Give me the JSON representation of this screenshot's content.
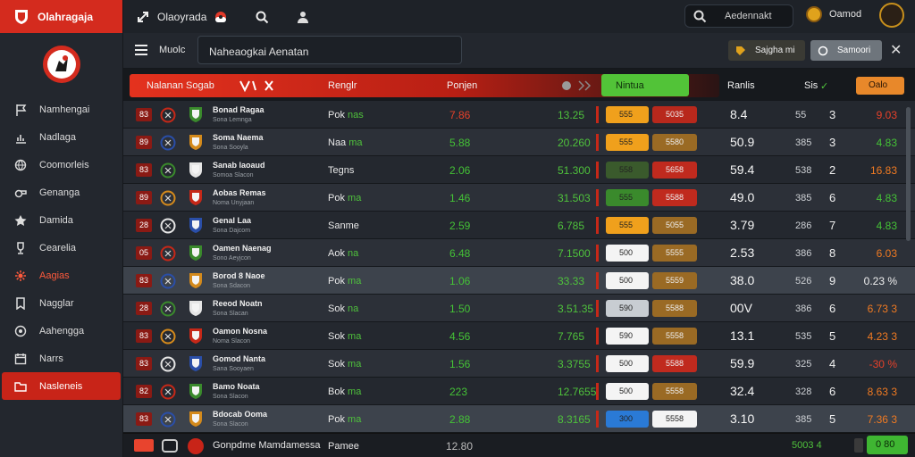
{
  "app": {
    "title": "Olahragaja"
  },
  "topbar": {
    "title": "Olaoyrada",
    "search_text": "Aedennakt",
    "coin_label": "Oamod"
  },
  "subbar": {
    "menu_label": "Muolc",
    "field_value": "Naheaogkai Aenatan",
    "btn1_label": "Sajgha mi",
    "btn2_label": "Samoori"
  },
  "sidebar": {
    "items": [
      {
        "label": "Namhengai",
        "icon": "flag-icon"
      },
      {
        "label": "Nadlaga",
        "icon": "chart-icon"
      },
      {
        "label": "Coomorleis",
        "icon": "globe-icon"
      },
      {
        "label": "Genanga",
        "icon": "whistle-icon"
      },
      {
        "label": "Damida",
        "icon": "star-icon"
      },
      {
        "label": "Cearelia",
        "icon": "trophy-icon"
      },
      {
        "label": "Aagias",
        "icon": "gear-icon"
      },
      {
        "label": "Nagglar",
        "icon": "bookmark-icon"
      },
      {
        "label": "Aahengga",
        "icon": "target-icon"
      },
      {
        "label": "Narrs",
        "icon": "calendar-icon"
      },
      {
        "label": "Nasleneis",
        "icon": "folder-icon"
      }
    ]
  },
  "table": {
    "headers": {
      "team": "Nalanan Sogab",
      "col2": "Renglr",
      "col3": "Ponjen",
      "col4": "Nintua",
      "col5": "Ranlis",
      "col7": "Sis",
      "col8": "Oalo"
    },
    "rows": [
      {
        "rank": "83",
        "team": "Bonad Ragaa",
        "sub": "Sona Lemnga",
        "c2a": "Pok",
        "c2b": "nas",
        "c3": "7.86",
        "c3c": "red",
        "c4": "13.25",
        "b1": "555",
        "b1c": "#f0a01c",
        "b2": "5035",
        "b2c": "#b8281c",
        "c5": "8.4",
        "c6": "55",
        "c7": "3",
        "c8": "9.03",
        "c8c": "red"
      },
      {
        "rank": "89",
        "team": "Soma Naema",
        "sub": "Sona Sooyla",
        "c2a": "Naa",
        "c2b": "ma",
        "c3": "5.88",
        "c3c": "green",
        "c4": "20.260",
        "b1": "555",
        "b1c": "#f0a01c",
        "b2": "5580",
        "b2c": "#9a6a24",
        "c5": "50.9",
        "c6": "385",
        "c7": "3",
        "c8": "4.83",
        "c8c": "green"
      },
      {
        "rank": "83",
        "team": "Sanab laoaud",
        "sub": "Somoa Slacon",
        "c2a": "Tegns",
        "c2b": "",
        "c3": "2.06",
        "c3c": "green",
        "c4": "51.300",
        "b1": "558",
        "b1c": "#3a5a2c",
        "b2": "5658",
        "b2c": "#c02a1e",
        "c5": "59.4",
        "c6": "538",
        "c7": "2",
        "c8": "16.83",
        "c8c": "orange"
      },
      {
        "rank": "89",
        "team": "Aobas Remas",
        "sub": "Noma Unyjaan",
        "c2a": "Pok",
        "c2b": "ma",
        "c3": "1.46",
        "c3c": "green",
        "c4": "31.503",
        "b1": "555",
        "b1c": "#3a8a2c",
        "b2": "5588",
        "b2c": "#c02a1e",
        "c5": "49.0",
        "c6": "385",
        "c7": "6",
        "c8": "4.83",
        "c8c": "green"
      },
      {
        "rank": "28",
        "team": "Genal Laa",
        "sub": "Sona Dajcom",
        "c2a": "Sanme",
        "c2b": "",
        "c3": "2.59",
        "c3c": "green",
        "c4": "6.785",
        "b1": "555",
        "b1c": "#f0a01c",
        "b2": "5055",
        "b2c": "#9a6a24",
        "c5": "3.79",
        "c6": "286",
        "c7": "7",
        "c8": "4.83",
        "c8c": "green"
      },
      {
        "rank": "05",
        "team": "Oamen Naenag",
        "sub": "Sono Aeyjcon",
        "c2a": "Aok",
        "c2b": "na",
        "c3": "6.48",
        "c3c": "green",
        "c4": "7.1500",
        "b1": "500",
        "b1c": "#f4f4f4",
        "b2": "5555",
        "b2c": "#9a6a24",
        "c5": "2.53",
        "c6": "386",
        "c7": "8",
        "c8": "6.03",
        "c8c": "orange"
      },
      {
        "rank": "83",
        "team": "Borod 8 Naoe",
        "sub": "Sona Sdacon",
        "c2a": "Pok",
        "c2b": "ma",
        "c3": "1.06",
        "c3c": "green",
        "c4": "33.33",
        "b1": "500",
        "b1c": "#f4f4f4",
        "b2": "5559",
        "b2c": "#9a6a24",
        "c5": "38.0",
        "c6": "526",
        "c7": "9",
        "c8": "0.23 %",
        "c8c": "white",
        "hl": true
      },
      {
        "rank": "28",
        "team": "Reeod Noatn",
        "sub": "Sona Slacan",
        "c2a": "Sok",
        "c2b": "na",
        "c3": "1.50",
        "c3c": "green",
        "c4": "3.51.35",
        "b1": "590",
        "b1c": "#c8cdd2",
        "b2": "5588",
        "b2c": "#9a6a24",
        "c5": "00V",
        "c6": "386",
        "c7": "6",
        "c8": "6.73 3",
        "c8c": "orange"
      },
      {
        "rank": "83",
        "team": "Oamon Nosna",
        "sub": "Noma Slacon",
        "c2a": "Sok",
        "c2b": "ma",
        "c3": "4.56",
        "c3c": "green",
        "c4": "7.765",
        "b1": "590",
        "b1c": "#f4f4f4",
        "b2": "5558",
        "b2c": "#9a6a24",
        "c5": "13.1",
        "c6": "535",
        "c7": "5",
        "c8": "4.23 3",
        "c8c": "orange"
      },
      {
        "rank": "83",
        "team": "Gomod Nanta",
        "sub": "Sana Sooyaen",
        "c2a": "Sok",
        "c2b": "ma",
        "c3": "1.56",
        "c3c": "green",
        "c4": "3.3755",
        "b1": "500",
        "b1c": "#f4f4f4",
        "b2": "5588",
        "b2c": "#c02a1e",
        "c5": "59.9",
        "c6": "325",
        "c7": "4",
        "c8": "-30 %",
        "c8c": "red"
      },
      {
        "rank": "82",
        "team": "Bamo Noata",
        "sub": "Sona Slacon",
        "c2a": "Bok",
        "c2b": "ma",
        "c3": "223",
        "c3c": "green",
        "c4": "12.7655",
        "b1": "500",
        "b1c": "#f4f4f4",
        "b2": "5558",
        "b2c": "#9a6a24",
        "c5": "32.4",
        "c6": "328",
        "c7": "6",
        "c8": "8.63 3",
        "c8c": "orange"
      },
      {
        "rank": "83",
        "team": "Bdocab Ooma",
        "sub": "Sona Slacon",
        "c2a": "Pok",
        "c2b": "ma",
        "c3": "2.88",
        "c3c": "green",
        "c4": "8.3165",
        "b1": "300",
        "b1c": "#2a7ad6",
        "b2": "5558",
        "b2c": "#f4f4f4",
        "c5": "3.10",
        "c6": "385",
        "c7": "5",
        "c8": "7.36 3",
        "c8c": "orange",
        "hl": true
      }
    ]
  },
  "footer": {
    "team": "Gonpdme Mamdamessa",
    "c2": "Pamee",
    "c3": "12.80",
    "summary": "5003 4",
    "c8": "0 80"
  },
  "colors": {
    "accent": "#d42b1e",
    "positive": "#44c236",
    "negative": "#e6402a",
    "warning": "#f07a22"
  }
}
